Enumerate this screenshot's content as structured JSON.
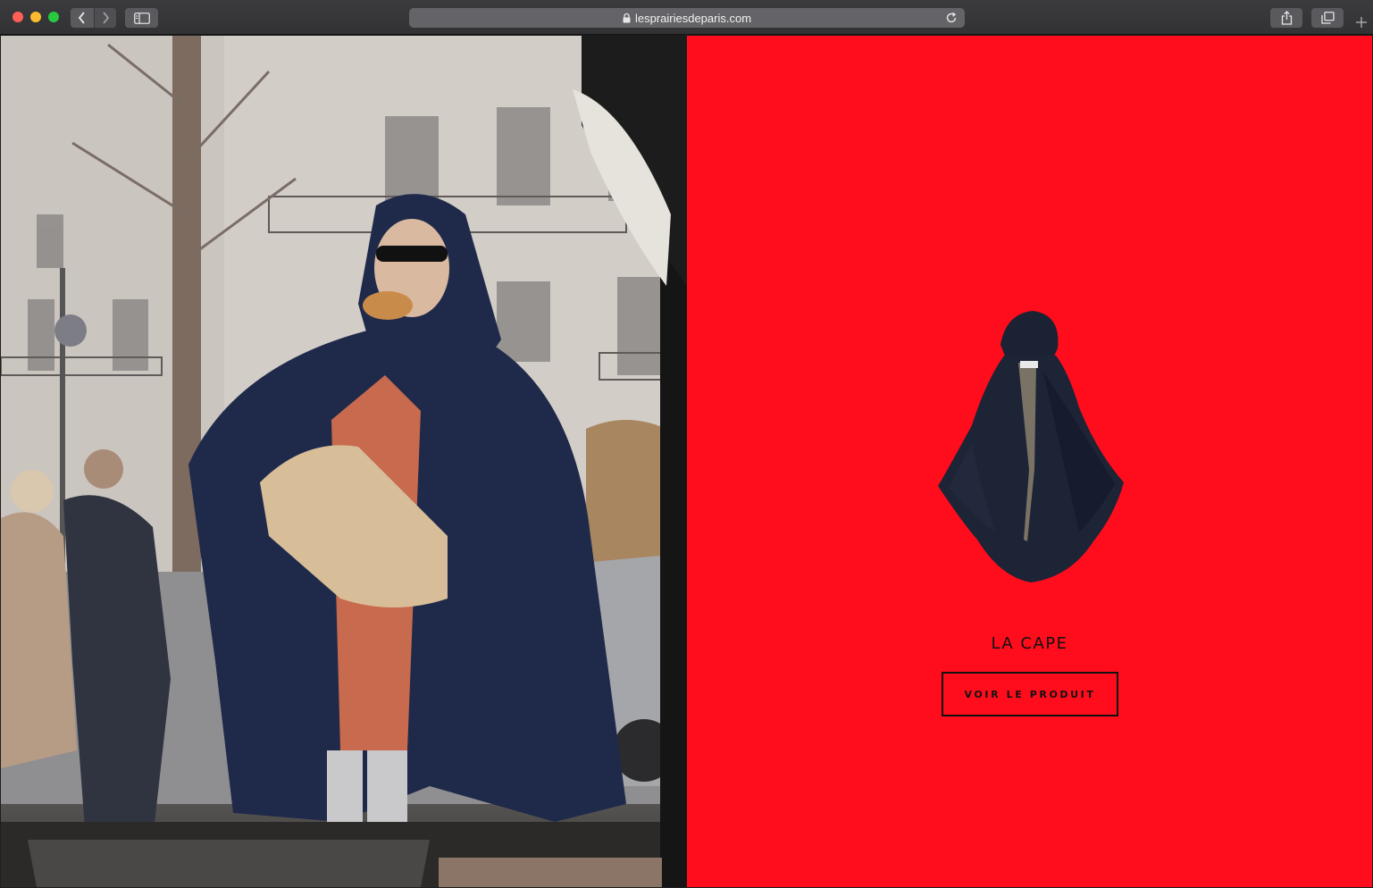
{
  "browser": {
    "url": "lesprairiesdeparis.com",
    "icons": {
      "back": "chevron-left-icon",
      "forward": "chevron-right-icon",
      "sidebar": "sidebar-icon",
      "lock": "lock-icon",
      "reload": "reload-icon",
      "share": "share-icon",
      "tabs": "tabs-overview-icon",
      "new_tab": "plus-icon"
    },
    "traffic_lights": [
      "#ff5f57",
      "#febc2e",
      "#28c840"
    ]
  },
  "product": {
    "title": "LA CAPE",
    "button_label": "VOIR LE PRODUIT"
  },
  "colors": {
    "panel_background": "#ff0d1c",
    "text": "#111111"
  }
}
